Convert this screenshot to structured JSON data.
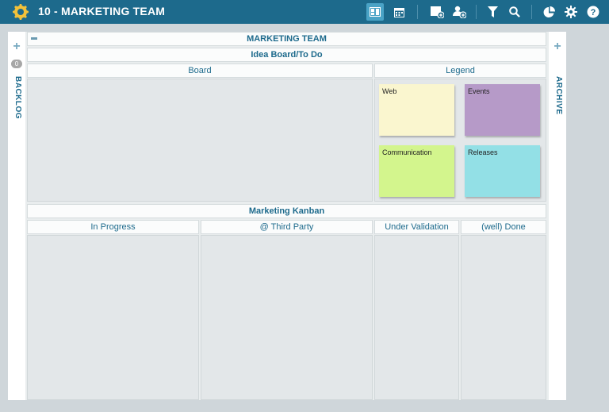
{
  "topbar": {
    "title": "10 - MARKETING TEAM",
    "icons": [
      "logo-icon",
      "board-view-icon",
      "calendar-icon",
      "add-card-icon",
      "add-user-icon",
      "filter-icon",
      "search-icon",
      "chart-icon",
      "settings-icon",
      "help-icon"
    ]
  },
  "backlog": {
    "label": "BACKLOG",
    "count": "0"
  },
  "archive": {
    "label": "ARCHIVE"
  },
  "board": {
    "title": "MARKETING TEAM",
    "idea_section": "Idea Board/To Do",
    "board_col": "Board",
    "legend_col": "Legend",
    "legend": [
      {
        "label": "Web",
        "color": "#faf6cf"
      },
      {
        "label": "Events",
        "color": "#b69ac8"
      },
      {
        "label": "Communication",
        "color": "#d3f58d"
      },
      {
        "label": "Releases",
        "color": "#93e0e6"
      }
    ],
    "kanban_section": "Marketing Kanban",
    "columns": [
      "In Progress",
      "@ Third Party",
      "Under Validation",
      "(well) Done"
    ]
  }
}
